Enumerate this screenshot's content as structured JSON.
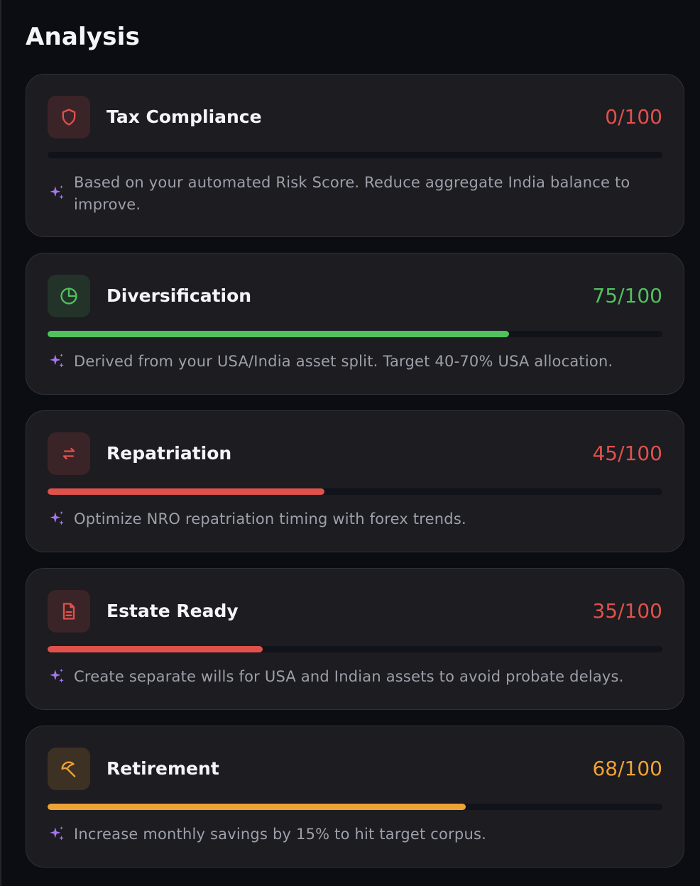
{
  "page": {
    "title": "Analysis"
  },
  "colors": {
    "red": "#e0514c",
    "green": "#51c15d",
    "orange": "#eea236",
    "sparkle": "#a674f0"
  },
  "cards": [
    {
      "key": "tax",
      "title": "Tax Compliance",
      "score_text": "0/100",
      "score": 0,
      "icon": "shield-icon",
      "tone": "red",
      "hint": "Based on your automated Risk Score. Reduce aggregate India balance to improve."
    },
    {
      "key": "diversification",
      "title": "Diversification",
      "score_text": "75/100",
      "score": 75,
      "icon": "pie-chart-icon",
      "tone": "green",
      "hint": "Derived from your USA/India asset split. Target 40-70% USA allocation."
    },
    {
      "key": "repatriation",
      "title": "Repatriation",
      "score_text": "45/100",
      "score": 45,
      "icon": "transfer-arrows-icon",
      "tone": "red",
      "hint": "Optimize NRO repatriation timing with forex trends."
    },
    {
      "key": "estate",
      "title": "Estate Ready",
      "score_text": "35/100",
      "score": 35,
      "icon": "document-icon",
      "tone": "red",
      "hint": "Create separate wills for USA and Indian assets to avoid probate delays."
    },
    {
      "key": "retirement",
      "title": "Retirement",
      "score_text": "68/100",
      "score": 68,
      "icon": "umbrella-icon",
      "tone": "orange",
      "hint": "Increase monthly savings by 15% to hit target corpus."
    }
  ]
}
